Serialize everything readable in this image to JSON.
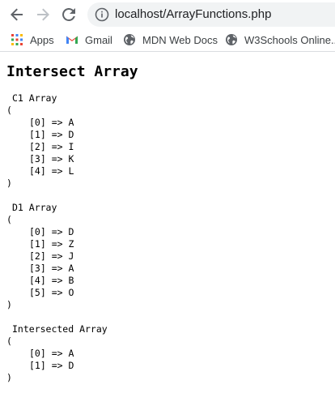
{
  "browser": {
    "url": "localhost/ArrayFunctions.php",
    "bookmarks": [
      {
        "label": "Apps",
        "icon": "apps-grid-icon"
      },
      {
        "label": "Gmail",
        "icon": "gmail-icon"
      },
      {
        "label": "MDN Web Docs",
        "icon": "globe-icon"
      },
      {
        "label": "W3Schools Online...",
        "icon": "globe-icon"
      }
    ]
  },
  "page": {
    "title": "Intersect Array",
    "blocks": [
      {
        "label": "C1 Array",
        "open": "(",
        "items": [
          "[0] => A",
          "[1] => D",
          "[2] => I",
          "[3] => K",
          "[4] => L"
        ],
        "close": ")"
      },
      {
        "label": "D1 Array",
        "open": "(",
        "items": [
          "[0] => D",
          "[1] => Z",
          "[2] => J",
          "[3] => A",
          "[4] => B",
          "[5] => O"
        ],
        "close": ")"
      },
      {
        "label": "Intersected Array",
        "open": "(",
        "items": [
          "[0] => A",
          "[1] => D"
        ],
        "close": ")"
      }
    ]
  },
  "colors": {
    "chrome_icon": "#5f6368",
    "omnibox_bg": "#f1f3f4",
    "gmail_red": "#ea4335"
  }
}
